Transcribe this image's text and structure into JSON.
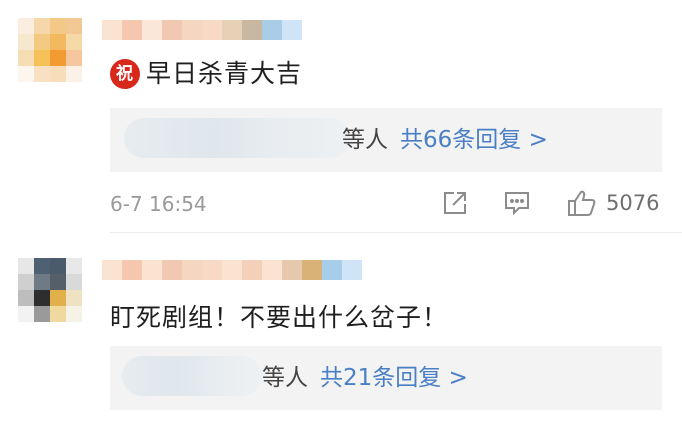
{
  "comments": [
    {
      "badge": "祝",
      "text": "早日杀青大吉",
      "reply_who": "等人",
      "reply_link": "共66条回复 >",
      "time": "6-7 16:54",
      "likes": "5076",
      "avatar_colors": [
        "#fbeee0",
        "#f6d7a9",
        "#f4c886",
        "#f2c894",
        "#f6e7cf",
        "#f4ca82",
        "#f3b95e",
        "#f5d9a6",
        "#f6ddb4",
        "#f7c15a",
        "#f29b33",
        "#f6c79e",
        "#fdf6ee",
        "#f7e1c2",
        "#f8ddba",
        "#fbf1e6"
      ],
      "name_colors": [
        "#fbe3d2",
        "#f4c7ae",
        "#fbe7d9",
        "#f1c8b2",
        "#f5d6c1",
        "#f7d9c6",
        "#e6d0b6",
        "#c8b8a1",
        "#a9cce9",
        "#cfe4f6"
      ]
    },
    {
      "text": "盯死剧组！不要出什么岔子！",
      "reply_who": "等人",
      "reply_link": "共21条回复 >",
      "avatar_colors": [
        "#e7e7e7",
        "#4e6173",
        "#4b5b6b",
        "#e8e8e8",
        "#cfcfcf",
        "#6e7a86",
        "#555f69",
        "#d9d9d9",
        "#bdbdbd",
        "#2e2e2e",
        "#e1b04b",
        "#efe2c2",
        "#f2f2f2",
        "#9a9a9a",
        "#f0d99f",
        "#f7f2e6"
      ],
      "name_colors": [
        "#fbe3d2",
        "#f4c7ae",
        "#fbe3d2",
        "#f1c8b2",
        "#f5d6c1",
        "#f7d9c6",
        "#fbe3d2",
        "#f4d0bb",
        "#fbe3d2",
        "#e6c9ad",
        "#d9b277",
        "#a8cdea",
        "#cfe4f6"
      ]
    }
  ]
}
